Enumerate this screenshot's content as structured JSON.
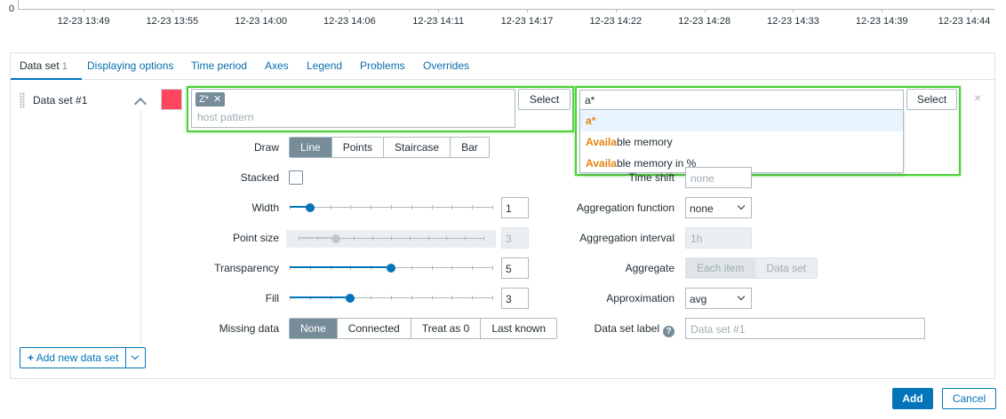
{
  "timeline": {
    "zero_label": "0",
    "labels": [
      "12-23 13:49",
      "12-23 13:55",
      "12-23 14:00",
      "12-23 14:06",
      "12-23 14:11",
      "12-23 14:17",
      "12-23 14:22",
      "12-23 14:28",
      "12-23 14:33",
      "12-23 14:39",
      "12-23 14:44"
    ]
  },
  "tabs": [
    {
      "label": "Data set",
      "count": "1",
      "active": true
    },
    {
      "label": "Displaying options"
    },
    {
      "label": "Time period"
    },
    {
      "label": "Axes"
    },
    {
      "label": "Legend"
    },
    {
      "label": "Problems"
    },
    {
      "label": "Overrides"
    }
  ],
  "dataset": {
    "title": "Data set #1",
    "color": "#ff465c",
    "host": {
      "chip": "Z*",
      "placeholder": "host pattern",
      "select_label": "Select"
    },
    "item": {
      "value": "a*",
      "select_label": "Select",
      "suggestions": [
        {
          "match": "a",
          "rest": "*"
        },
        {
          "match": "A",
          "mid": "vaila",
          "rest": "ble memory"
        },
        {
          "match": "A",
          "mid": "vaila",
          "rest": "ble memory in %"
        }
      ]
    },
    "close_label": "×"
  },
  "left": {
    "draw": {
      "label": "Draw",
      "options": [
        "Line",
        "Points",
        "Staircase",
        "Bar"
      ],
      "selected": "Line"
    },
    "stacked": {
      "label": "Stacked",
      "checked": false
    },
    "width": {
      "label": "Width",
      "value": "1",
      "level": 0.1
    },
    "point_size": {
      "label": "Point size",
      "value": "3",
      "level": 0.2
    },
    "transparency": {
      "label": "Transparency",
      "value": "5",
      "level": 0.5
    },
    "fill": {
      "label": "Fill",
      "value": "3",
      "level": 0.3
    },
    "missing_data": {
      "label": "Missing data",
      "options": [
        "None",
        "Connected",
        "Treat as 0",
        "Last known"
      ],
      "selected": "None"
    }
  },
  "right": {
    "time_shift": {
      "label": "Time shift",
      "placeholder": "none"
    },
    "aggregation_function": {
      "label": "Aggregation function",
      "value": "none"
    },
    "aggregation_interval": {
      "label": "Aggregation interval",
      "value": "1h"
    },
    "aggregate": {
      "label": "Aggregate",
      "options": [
        "Each item",
        "Data set"
      ],
      "selected": "Each item"
    },
    "approximation": {
      "label": "Approximation",
      "value": "avg"
    },
    "dataset_label": {
      "label": "Data set label",
      "help": "?",
      "placeholder": "Data set #1"
    }
  },
  "add_dataset": {
    "label": "Add new data set"
  },
  "footer": {
    "add_label": "Add",
    "cancel_label": "Cancel"
  },
  "colors": {
    "accent": "#0275b8",
    "highlight": "#4cd137",
    "swatch": "#ff465c",
    "match": "#e5830d"
  }
}
